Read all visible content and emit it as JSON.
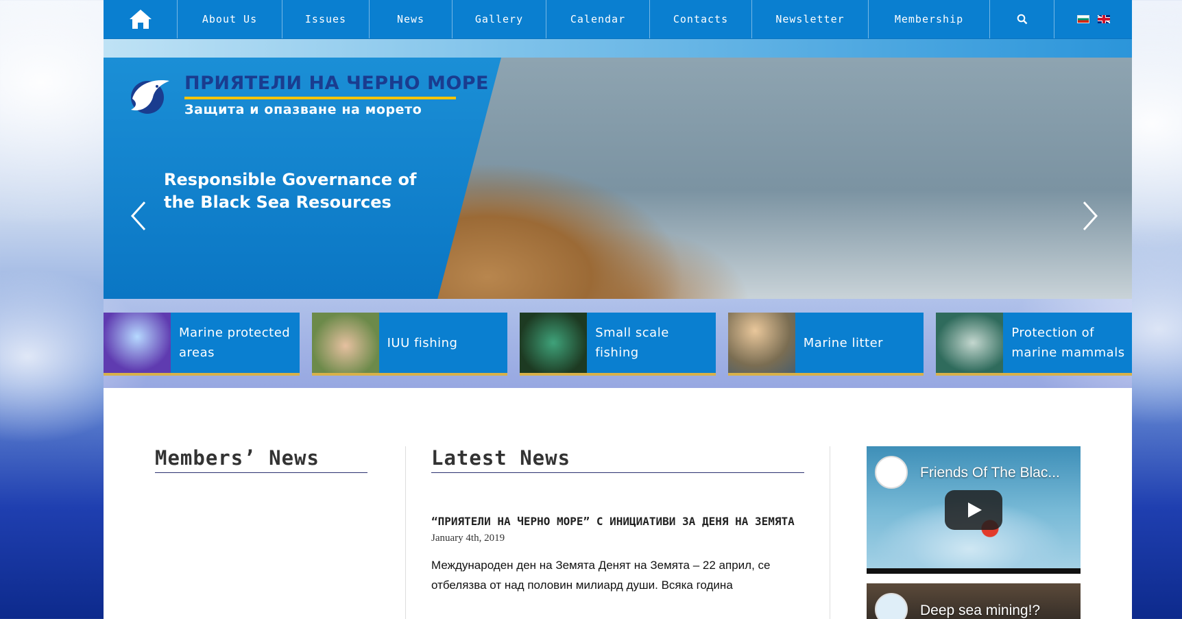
{
  "nav": {
    "items": [
      "About Us",
      "Issues",
      "News",
      "Gallery",
      "Calendar",
      "Contacts",
      "Newsletter",
      "Membership"
    ],
    "home_icon": "home-icon",
    "search_icon": "search-icon",
    "languages": [
      "bg-flag-icon",
      "en-flag-icon"
    ]
  },
  "hero": {
    "logo_line1": "ПРИЯТЕЛИ НА ЧЕРНО МОРЕ",
    "logo_line2": "Защита и опазване на морето",
    "slide_title": "Responsible Governance of the Black Sea Resources",
    "prev_icon": "chevron-left-icon",
    "next_icon": "chevron-right-icon"
  },
  "topics": [
    {
      "label": "Marine protected areas",
      "color": "#5f3bb0"
    },
    {
      "label": "IUU fishing",
      "color": "#6c8a4a"
    },
    {
      "label": "Small scale fishing",
      "color": "#1d5a3e"
    },
    {
      "label": "Marine litter",
      "color": "#7a6d52"
    },
    {
      "label": "Protection of marine mammals",
      "color": "#2f6b5c"
    }
  ],
  "members_news": {
    "title": "Members’ News"
  },
  "latest_news": {
    "title": "Latest News",
    "item_title": "“Приятели на Черно море” с инициативи за Деня на Земята",
    "item_date": "January 4th, 2019",
    "item_excerpt": "Международен ден на Земята Денят на Земята – 22 април, се отбелязва от над половин милиард души. Всяка година"
  },
  "videos": [
    {
      "title": "Friends Of The Blac..."
    },
    {
      "title": "Deep sea mining!?"
    }
  ],
  "colors": {
    "brand_blue": "#0a7fd0",
    "logo_navy": "#1a3c8f",
    "accent_gold": "#d8b14a"
  }
}
